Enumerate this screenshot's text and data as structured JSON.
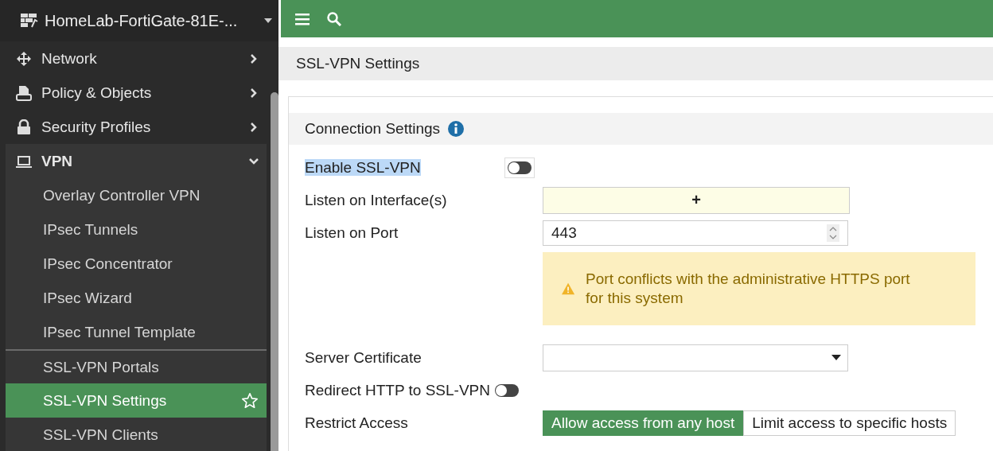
{
  "sidebar": {
    "device": "HomeLab-FortiGate-81E-...",
    "items": [
      {
        "label": "Network",
        "expanded": false
      },
      {
        "label": "Policy & Objects",
        "expanded": false
      },
      {
        "label": "Security Profiles",
        "expanded": false
      },
      {
        "label": "VPN",
        "expanded": true,
        "children": [
          {
            "label": "Overlay Controller VPN",
            "selected": false
          },
          {
            "label": "IPsec Tunnels",
            "selected": false
          },
          {
            "label": "IPsec Concentrator",
            "selected": false
          },
          {
            "label": "IPsec Wizard",
            "selected": false
          },
          {
            "label": "IPsec Tunnel Template",
            "selected": false
          },
          {
            "label": "SSL-VPN Portals",
            "selected": false
          },
          {
            "label": "SSL-VPN Settings",
            "selected": true
          },
          {
            "label": "SSL-VPN Clients",
            "selected": false
          }
        ]
      }
    ]
  },
  "breadcrumb": "SSL-VPN Settings",
  "section": {
    "title": "Connection Settings",
    "rows": [
      {
        "kind": "toggle",
        "label": "Enable SSL-VPN",
        "on": false,
        "highlighted": true
      },
      {
        "kind": "add",
        "label": "Listen on Interface(s)",
        "value": "+"
      },
      {
        "kind": "number",
        "label": "Listen on Port",
        "value": "443"
      },
      {
        "kind": "warning",
        "text": "Port conflicts with the administrative HTTPS port for this system"
      },
      {
        "kind": "select",
        "label": "Server Certificate"
      },
      {
        "kind": "inline-toggle",
        "label": "Redirect HTTP to SSL-VPN",
        "on": false
      },
      {
        "kind": "segmented",
        "label": "Restrict Access",
        "options": [
          {
            "label": "Allow access from any host",
            "selected": true
          },
          {
            "label": "Limit access to specific hosts",
            "selected": false
          }
        ]
      }
    ]
  }
}
